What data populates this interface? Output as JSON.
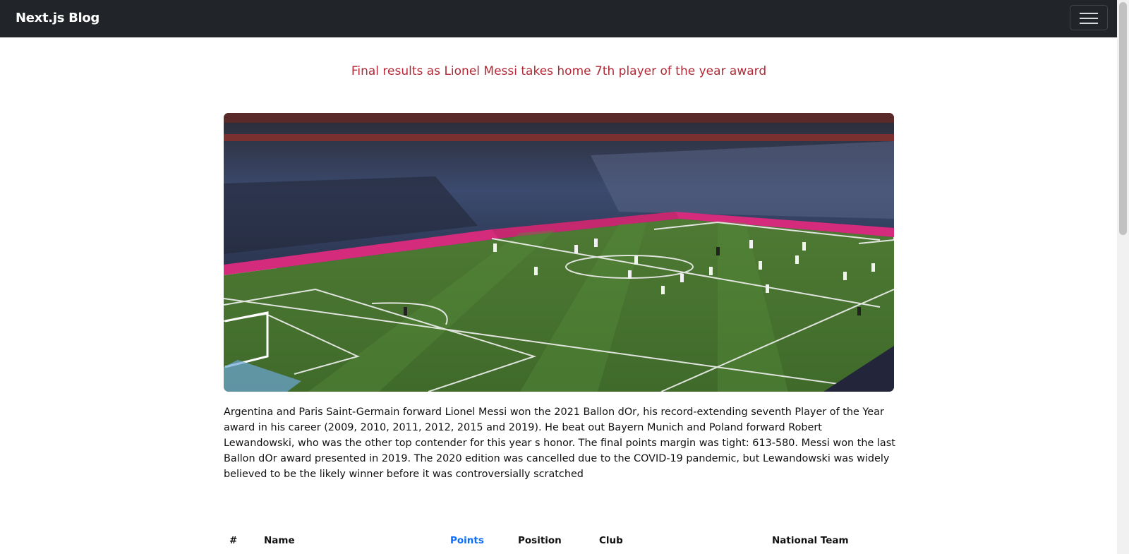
{
  "navbar": {
    "brand": "Next.js Blog",
    "menu_icon": "hamburger-icon"
  },
  "article": {
    "title": "Final results as Lionel Messi takes home 7th player of the year award",
    "image_alt": "football-stadium-photo",
    "body": "Argentina and Paris Saint-Germain forward Lionel Messi won the 2021 Ballon dOr, his record-extending seventh Player of the Year award in his career (2009, 2010, 2011, 2012, 2015 and 2019). He beat out Bayern Munich and Poland forward Robert Lewandowski, who was the other top contender for this year s honor. The final points margin was tight: 613-580. Messi won the last Ballon dOr award presented in 2019. The 2020 edition was cancelled due to the COVID-19 pandemic, but Lewandowski was widely believed to be the likely winner before it was controversially scratched"
  },
  "table": {
    "headers": [
      "#",
      "Name",
      "Points",
      "Position",
      "Club",
      "National Team"
    ],
    "sorted_column": "Points"
  },
  "colors": {
    "navbar": "#212529",
    "title": "#b02a37",
    "sort_header": "#0d6efd"
  }
}
